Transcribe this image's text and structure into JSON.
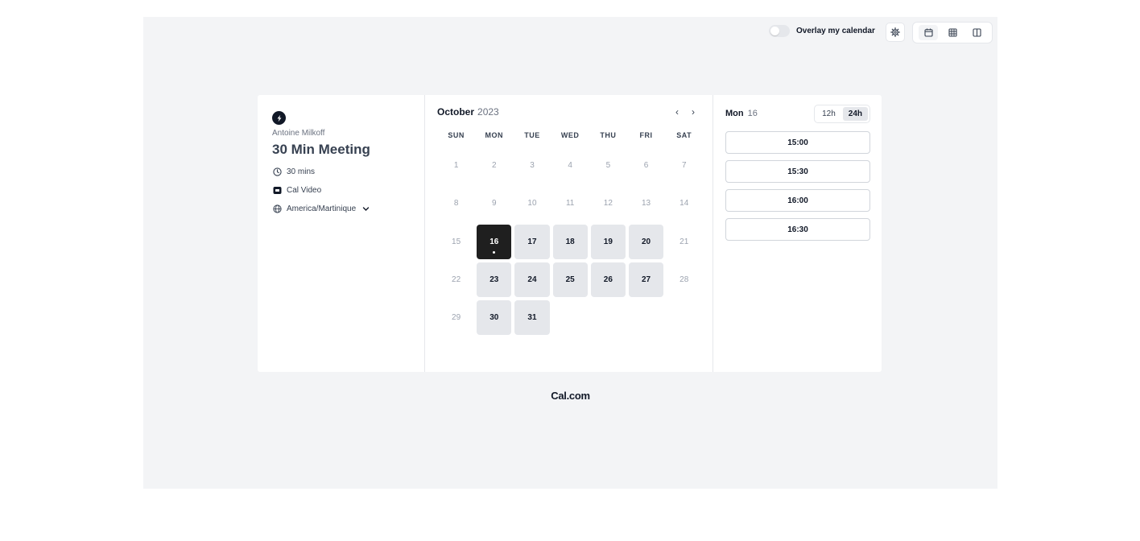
{
  "toolbar": {
    "overlay_label": "Overlay my calendar",
    "overlay_enabled": false,
    "settings_icon": "gear-icon",
    "views": [
      {
        "name": "month-view",
        "icon": "calendar-icon",
        "active": true
      },
      {
        "name": "week-view",
        "icon": "grid-icon",
        "active": false
      },
      {
        "name": "column-view",
        "icon": "columns-icon",
        "active": false
      }
    ]
  },
  "event": {
    "host": "Antoine Milkoff",
    "title": "30 Min Meeting",
    "duration": "30 mins",
    "location": "Cal Video",
    "timezone": "America/Martinique"
  },
  "calendar": {
    "month": "October",
    "year": "2023",
    "weekdays": [
      "SUN",
      "MON",
      "TUE",
      "WED",
      "THU",
      "FRI",
      "SAT"
    ],
    "days": [
      {
        "d": "1",
        "s": "off"
      },
      {
        "d": "2",
        "s": "off"
      },
      {
        "d": "3",
        "s": "off"
      },
      {
        "d": "4",
        "s": "off"
      },
      {
        "d": "5",
        "s": "off"
      },
      {
        "d": "6",
        "s": "off"
      },
      {
        "d": "7",
        "s": "off"
      },
      {
        "d": "8",
        "s": "off"
      },
      {
        "d": "9",
        "s": "off"
      },
      {
        "d": "10",
        "s": "off"
      },
      {
        "d": "11",
        "s": "off"
      },
      {
        "d": "12",
        "s": "off"
      },
      {
        "d": "13",
        "s": "off"
      },
      {
        "d": "14",
        "s": "off"
      },
      {
        "d": "15",
        "s": "off"
      },
      {
        "d": "16",
        "s": "sel"
      },
      {
        "d": "17",
        "s": "avail"
      },
      {
        "d": "18",
        "s": "avail"
      },
      {
        "d": "19",
        "s": "avail"
      },
      {
        "d": "20",
        "s": "avail"
      },
      {
        "d": "21",
        "s": "off"
      },
      {
        "d": "22",
        "s": "off"
      },
      {
        "d": "23",
        "s": "avail"
      },
      {
        "d": "24",
        "s": "avail"
      },
      {
        "d": "25",
        "s": "avail"
      },
      {
        "d": "26",
        "s": "avail"
      },
      {
        "d": "27",
        "s": "avail"
      },
      {
        "d": "28",
        "s": "off"
      },
      {
        "d": "29",
        "s": "off"
      },
      {
        "d": "30",
        "s": "avail"
      },
      {
        "d": "31",
        "s": "avail"
      }
    ]
  },
  "slots": {
    "day_name": "Mon",
    "day_num": "16",
    "format_12": "12h",
    "format_24": "24h",
    "format_active": "24h",
    "times": [
      "15:00",
      "15:30",
      "16:00",
      "16:30"
    ]
  },
  "brand": "Cal.com",
  "colors": {
    "background": "#f3f4f6",
    "selected_day": "#1f1f1f",
    "available_day": "#e5e7eb"
  }
}
